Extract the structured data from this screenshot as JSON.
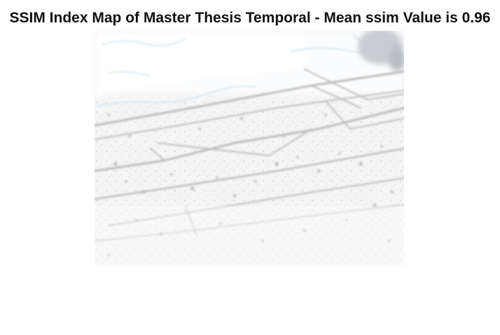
{
  "figure": {
    "title": "SSIM Index Map of Master Thesis Temporal - Mean ssim Value is 0.96"
  },
  "colors": {
    "background": "#ffffff",
    "map_base": "#f4f4f4",
    "map_edges": "#b8b8b8",
    "map_tint": "#cfe3ef"
  }
}
